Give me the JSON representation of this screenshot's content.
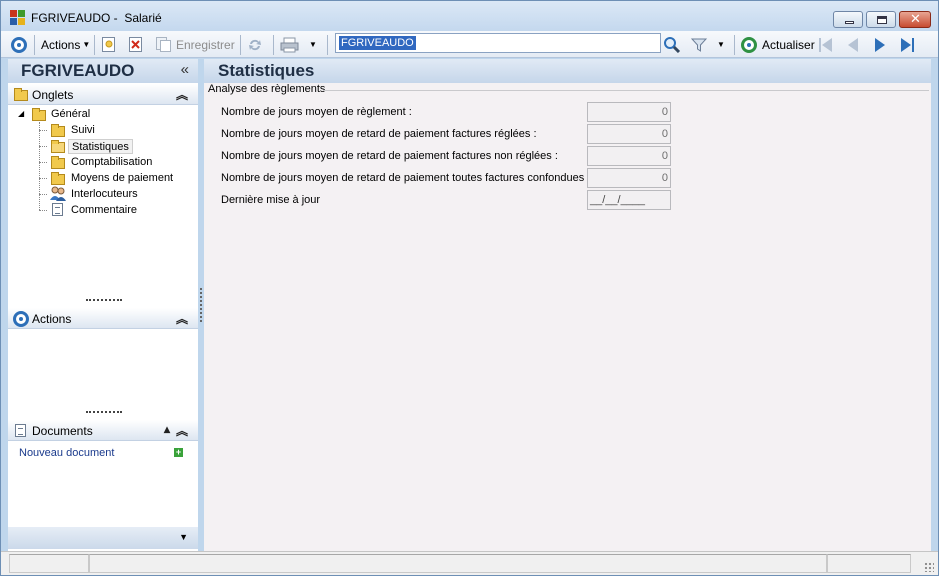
{
  "window": {
    "title": "FGRIVEAUDO -  Salarié"
  },
  "toolbar": {
    "actions_label": "Actions",
    "save_label": "Enregistrer",
    "record_code": "FGRIVEAUDO",
    "refresh_label": "Actualiser"
  },
  "left_panel": {
    "title": "FGRIVEAUDO",
    "collapse_glyph": "«",
    "onglets_label": "Onglets",
    "tree_root": "Général",
    "tree_items": [
      {
        "label": "Suivi",
        "icon": "folder-icon"
      },
      {
        "label": "Statistiques",
        "icon": "open-folder-icon"
      },
      {
        "label": "Comptabilisation",
        "icon": "folder-icon"
      },
      {
        "label": "Moyens de paiement",
        "icon": "folder-icon"
      },
      {
        "label": "Interlocuteurs",
        "icon": "contacts-icon"
      },
      {
        "label": "Commentaire",
        "icon": "note-icon"
      }
    ],
    "actions_label": "Actions",
    "documents_label": "Documents",
    "new_document_label": "Nouveau document"
  },
  "main": {
    "title": "Statistiques",
    "group_title": "Analyse des règlements",
    "rows": [
      {
        "label": "Nombre de jours moyen de règlement :",
        "value": "0"
      },
      {
        "label": "Nombre de jours moyen de retard de paiement factures réglées :",
        "value": "0"
      },
      {
        "label": "Nombre de jours moyen de retard de paiement factures non réglées :",
        "value": "0"
      },
      {
        "label": "Nombre de jours moyen de retard de paiement toutes factures confondues :",
        "value": "0"
      }
    ],
    "last_update_label": "Dernière mise à jour",
    "last_update_value": "__/__/____"
  },
  "colors": {
    "accent_blue": "#2d6fb8",
    "header_gradient_top": "#e1eaf5",
    "header_gradient_bottom": "#c5d6ea",
    "form_background": "#f4f1f3",
    "selection": "#3068c0"
  }
}
